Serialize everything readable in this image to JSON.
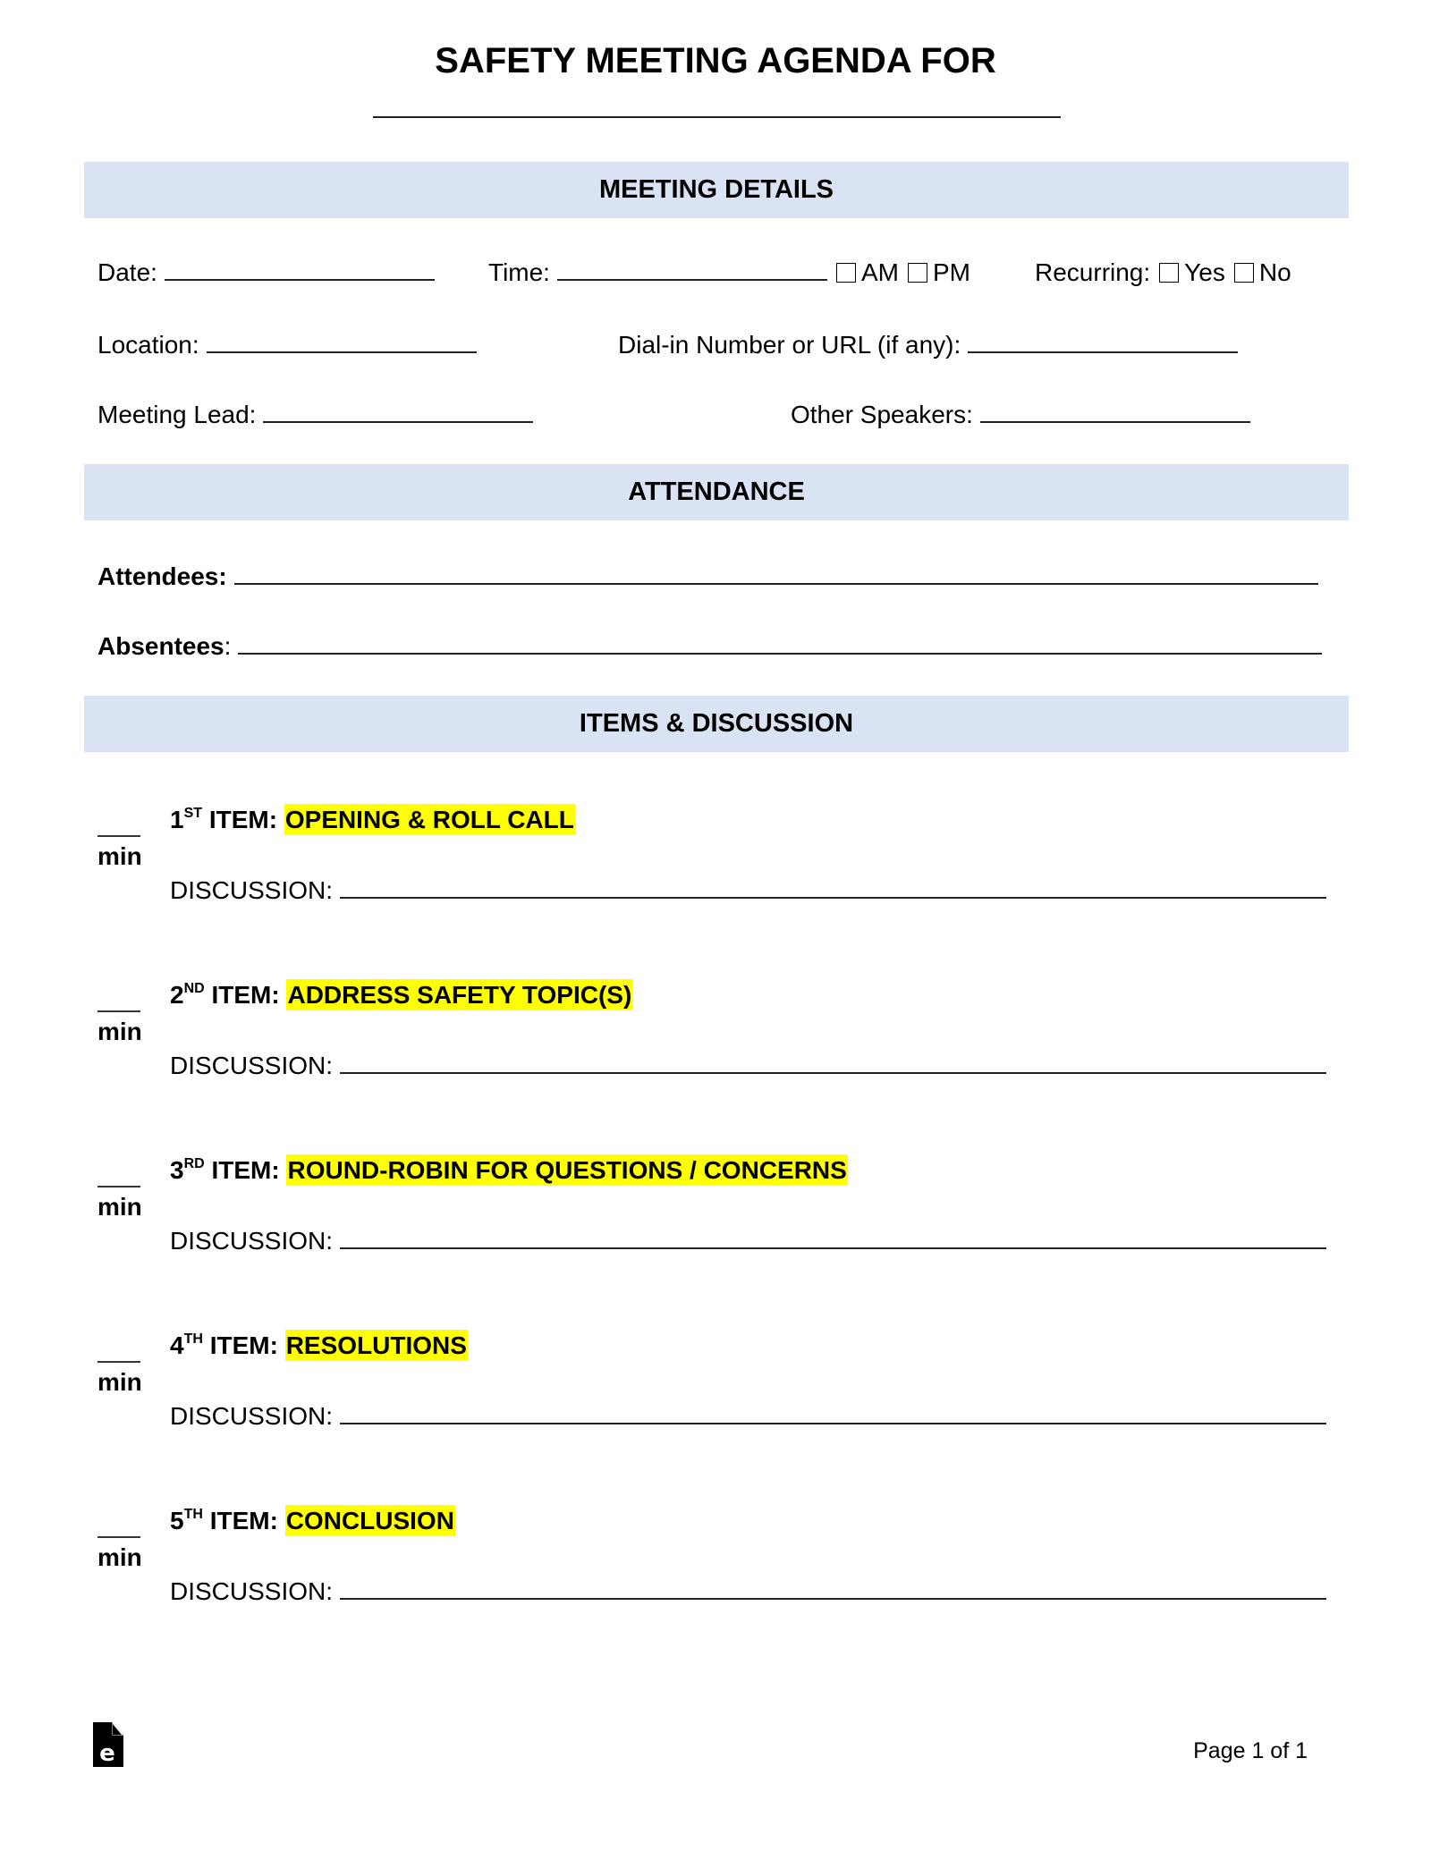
{
  "document": {
    "title": "SAFETY MEETING AGENDA FOR",
    "title_blank": ""
  },
  "sections": {
    "meeting_details": "MEETING DETAILS",
    "attendance": "ATTENDANCE",
    "items_discussion": "ITEMS & DISCUSSION"
  },
  "meeting_details": {
    "date_label": "Date:",
    "date_value": "",
    "time_label": "Time:",
    "time_value": "",
    "am_label": "AM",
    "pm_label": "PM",
    "am_checked": false,
    "pm_checked": false,
    "recurring_label": "Recurring:",
    "yes_label": "Yes",
    "no_label": "No",
    "yes_checked": false,
    "no_checked": false,
    "location_label": "Location:",
    "location_value": "",
    "dialin_label": "Dial-in Number or URL (if any):",
    "dialin_value": "",
    "lead_label": "Meeting Lead:",
    "lead_value": "",
    "speakers_label": "Other Speakers:",
    "speakers_value": ""
  },
  "attendance": {
    "attendees_label": "Attendees:",
    "attendees_value": "",
    "absentees_label": "Absentees",
    "absentees_colon": ":",
    "absentees_value": ""
  },
  "items": [
    {
      "num": "1",
      "suffix": "ST",
      "label": "ITEM:",
      "topic": "OPENING & ROLL CALL",
      "min_label": "min",
      "minutes": "",
      "discussion_label": "DISCUSSION:",
      "discussion": ""
    },
    {
      "num": "2",
      "suffix": "ND",
      "label": "ITEM:",
      "topic": "ADDRESS SAFETY TOPIC(S)",
      "min_label": "min",
      "minutes": "",
      "discussion_label": "DISCUSSION:",
      "discussion": ""
    },
    {
      "num": "3",
      "suffix": "RD",
      "label": "ITEM:",
      "topic": "ROUND-ROBIN FOR QUESTIONS / CONCERNS",
      "min_label": "min",
      "minutes": "",
      "discussion_label": "DISCUSSION:",
      "discussion": ""
    },
    {
      "num": "4",
      "suffix": "TH",
      "label": "ITEM:",
      "topic": "RESOLUTIONS",
      "min_label": "min",
      "minutes": "",
      "discussion_label": "DISCUSSION:",
      "discussion": ""
    },
    {
      "num": "5",
      "suffix": "TH",
      "label": "ITEM:",
      "topic": "CONCLUSION",
      "min_label": "min",
      "minutes": "",
      "discussion_label": "DISCUSSION:",
      "discussion": ""
    }
  ],
  "footer": {
    "logo_icon": "eforms-logo-icon",
    "logo_letter": "e",
    "page_label": "Page 1 of 1"
  },
  "colors": {
    "band": "#dae3f3",
    "highlight": "#ffff00"
  }
}
